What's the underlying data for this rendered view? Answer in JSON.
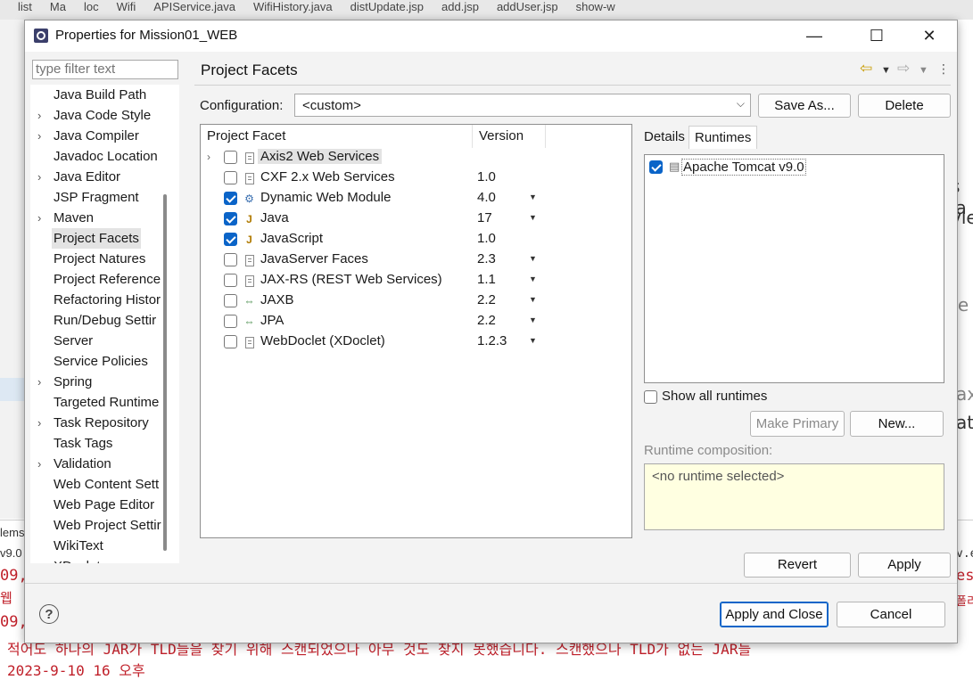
{
  "ide": {
    "tabs": [
      "list",
      "Ma",
      "loc",
      "Wifi",
      "APIService.java",
      "WifiHistory.java",
      "distUpdate.jsp",
      "add.jsp",
      "addUser.jsp",
      "show-w"
    ],
    "bg_right_text": [
      "s ja",
      "vle",
      "te",
      "ax",
      "at"
    ],
    "bg_left_text": [
      "lems",
      "v9.0"
    ],
    "console_lines": [
      "09,",
      " 웹",
      "09,",
      " 적어도 하나의 JAR가 TLD들을 찾기 위해 스캔되었으나 아무 것도 찾지 못했습니다. 스캔했으나 TLD가 없는 JAR들",
      "   2023-9-10 16 오후"
    ],
    "console_right": [
      "es",
      "폴리",
      "v.ex"
    ]
  },
  "dialog": {
    "title": "Properties for Mission01_WEB",
    "window_buttons": {
      "minimize": "—",
      "maximize": "☐",
      "close": "✕"
    },
    "filter_placeholder": "type filter text",
    "tree": [
      {
        "label": "Java Build Path",
        "expandable": false
      },
      {
        "label": "Java Code Style",
        "expandable": true
      },
      {
        "label": "Java Compiler",
        "expandable": true
      },
      {
        "label": "Javadoc Location",
        "expandable": false
      },
      {
        "label": "Java Editor",
        "expandable": true
      },
      {
        "label": "JSP Fragment",
        "expandable": false
      },
      {
        "label": "Maven",
        "expandable": true
      },
      {
        "label": "Project Facets",
        "expandable": false,
        "selected": true
      },
      {
        "label": "Project Natures",
        "expandable": false
      },
      {
        "label": "Project Reference",
        "expandable": false
      },
      {
        "label": "Refactoring Histor",
        "expandable": false
      },
      {
        "label": "Run/Debug Settir",
        "expandable": false
      },
      {
        "label": "Server",
        "expandable": false
      },
      {
        "label": "Service Policies",
        "expandable": false
      },
      {
        "label": "Spring",
        "expandable": true
      },
      {
        "label": "Targeted Runtime",
        "expandable": false
      },
      {
        "label": "Task Repository",
        "expandable": true
      },
      {
        "label": "Task Tags",
        "expandable": false
      },
      {
        "label": "Validation",
        "expandable": true
      },
      {
        "label": "Web Content Sett",
        "expandable": false
      },
      {
        "label": "Web Page Editor",
        "expandable": false
      },
      {
        "label": "Web Project Settir",
        "expandable": false
      },
      {
        "label": "WikiText",
        "expandable": false
      },
      {
        "label": "XDoclet",
        "expandable": true
      }
    ],
    "page_title": "Project Facets",
    "configuration": {
      "label": "Configuration:",
      "value": "<custom>"
    },
    "buttons": {
      "save_as": "Save As...",
      "delete": "Delete",
      "make_primary": "Make Primary",
      "new": "New...",
      "revert": "Revert",
      "apply": "Apply",
      "apply_and_close": "Apply and Close",
      "cancel": "Cancel",
      "help": "?"
    },
    "facets_table": {
      "col_facet": "Project Facet",
      "col_version": "Version",
      "rows": [
        {
          "name": "Axis2 Web Services",
          "version": "",
          "checked": false,
          "expandable": true,
          "icon": "doc-icon",
          "has_dropdown": false
        },
        {
          "name": "CXF 2.x Web Services",
          "version": "1.0",
          "checked": false,
          "expandable": false,
          "icon": "doc-icon",
          "has_dropdown": false
        },
        {
          "name": "Dynamic Web Module",
          "version": "4.0",
          "checked": true,
          "expandable": false,
          "icon": "web-module-icon",
          "has_dropdown": true
        },
        {
          "name": "Java",
          "version": "17",
          "checked": true,
          "expandable": false,
          "icon": "java-facet-icon",
          "has_dropdown": true
        },
        {
          "name": "JavaScript",
          "version": "1.0",
          "checked": true,
          "expandable": false,
          "icon": "javascript-facet-icon",
          "has_dropdown": false
        },
        {
          "name": "JavaServer Faces",
          "version": "2.3",
          "checked": false,
          "expandable": false,
          "icon": "doc-icon",
          "has_dropdown": true
        },
        {
          "name": "JAX-RS (REST Web Services)",
          "version": "1.1",
          "checked": false,
          "expandable": false,
          "icon": "doc-icon",
          "has_dropdown": true
        },
        {
          "name": "JAXB",
          "version": "2.2",
          "checked": false,
          "expandable": false,
          "icon": "arrows-icon",
          "has_dropdown": true
        },
        {
          "name": "JPA",
          "version": "2.2",
          "checked": false,
          "expandable": false,
          "icon": "arrows-icon",
          "has_dropdown": true
        },
        {
          "name": "WebDoclet (XDoclet)",
          "version": "1.2.3",
          "checked": false,
          "expandable": false,
          "icon": "doc-icon",
          "has_dropdown": true
        }
      ]
    },
    "tabs": {
      "details": "Details",
      "runtimes": "Runtimes"
    },
    "runtimes": [
      {
        "name": "Apache Tomcat v9.0",
        "checked": true
      }
    ],
    "show_all_runtimes": "Show all runtimes",
    "runtime_composition": {
      "label": "Runtime composition:",
      "value": "<no runtime selected>"
    },
    "colors": {
      "accent": "#0a64c8",
      "composition_bg": "#ffffe1",
      "console_red": "#c0202a"
    }
  }
}
